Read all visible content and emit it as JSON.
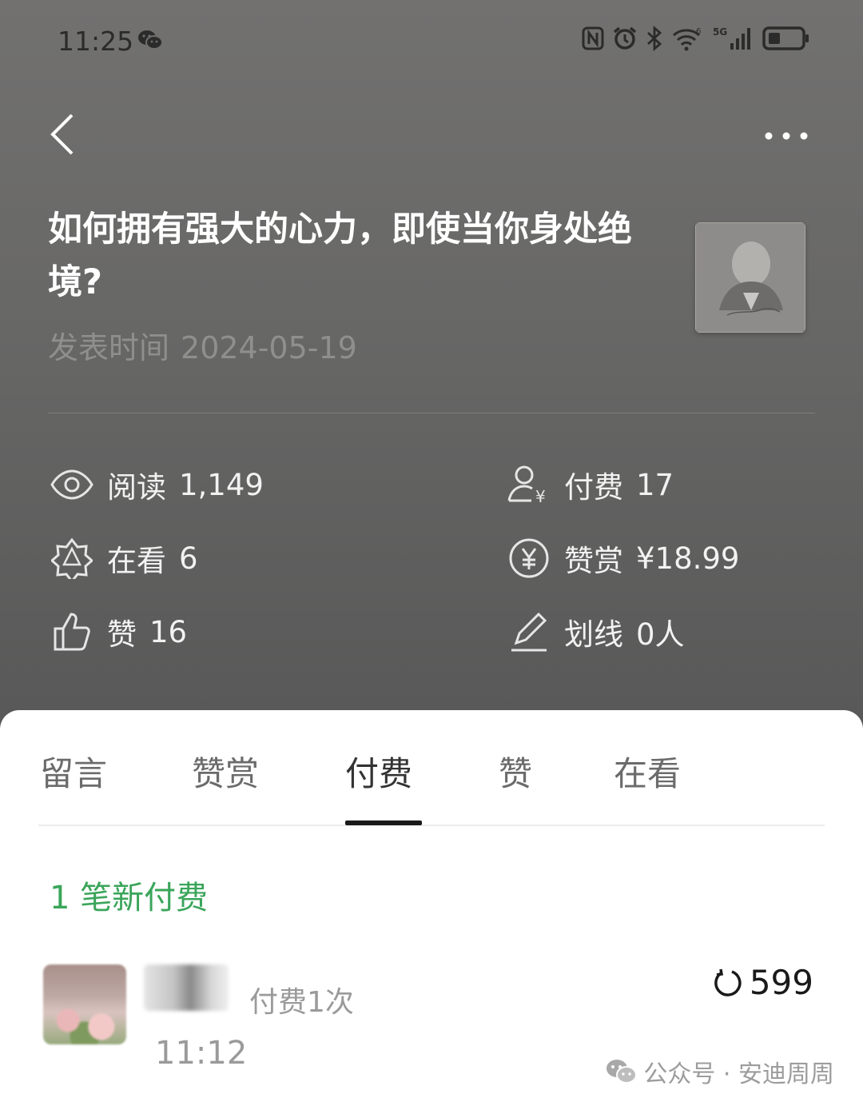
{
  "status_bar": {
    "time": "11:25",
    "icons": [
      "wechat-notification-icon",
      "nfc-icon",
      "alarm-icon",
      "bluetooth-icon",
      "wifi-6-icon",
      "5g-signal-icon",
      "battery-icon"
    ]
  },
  "header": {
    "back_icon": "chevron-left-icon",
    "more_icon": "more-dots-icon"
  },
  "article": {
    "title": "如何拥有强大的心力，即使当你身处绝境?",
    "publish_label": "发表时间",
    "publish_date": "2024-05-19"
  },
  "stats": {
    "reads_label": "阅读",
    "reads_value": "1,149",
    "paid_label": "付费",
    "paid_value": "17",
    "watching_label": "在看",
    "watching_value": "6",
    "reward_label": "赞赏",
    "reward_value": "¥18.99",
    "likes_label": "赞",
    "likes_value": "16",
    "underline_label": "划线",
    "underline_value": "0人"
  },
  "tabs": [
    {
      "label": "留言"
    },
    {
      "label": "赞赏"
    },
    {
      "label": "付费",
      "active": true
    },
    {
      "label": "赞"
    },
    {
      "label": "在看"
    }
  ],
  "payments": {
    "new_count_text": "1 笔新付费",
    "items": [
      {
        "count_text": "付费1次",
        "time": "11:12",
        "amount": "599"
      }
    ]
  },
  "watermark": {
    "text": "公众号 · 安迪周周"
  },
  "colors": {
    "header_bg": "#6c6b6a",
    "accent_green": "#3aa55a",
    "title_white": "#ffffff"
  }
}
